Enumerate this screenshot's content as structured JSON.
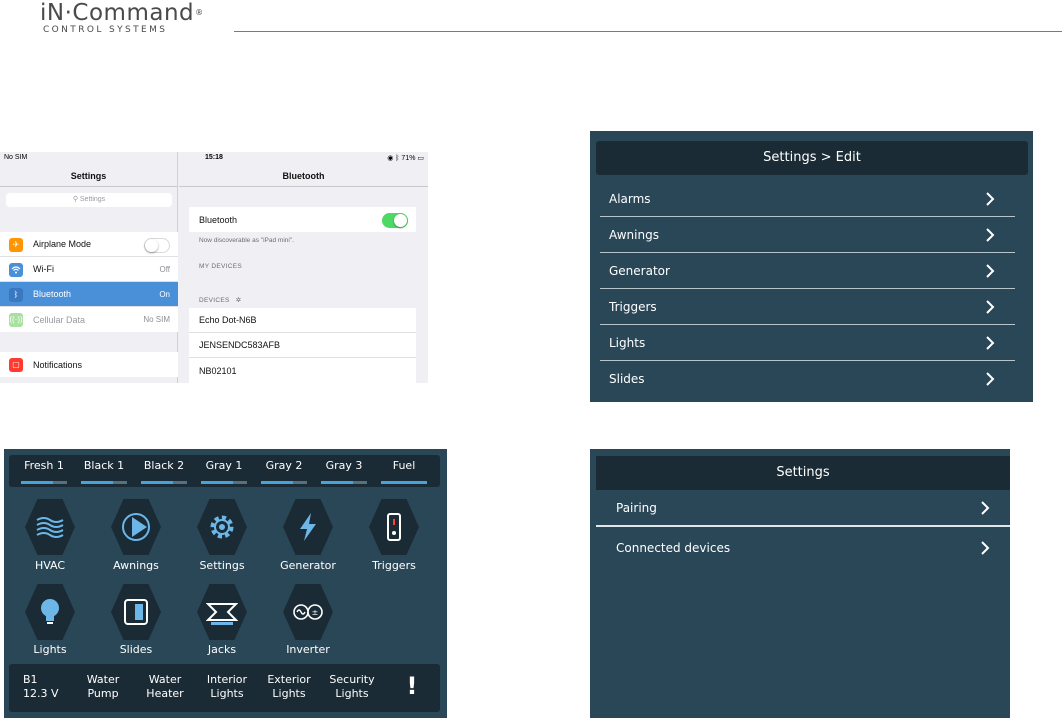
{
  "brand": {
    "name": "iN·Command",
    "registered": "®",
    "subtitle": "CONTROL SYSTEMS"
  },
  "ipad": {
    "status": {
      "carrier": "No SIM",
      "time": "15:18",
      "battery": "71%"
    },
    "left_title": "Settings",
    "search_placeholder": "Settings",
    "items": [
      {
        "label": "Airplane Mode",
        "value": "",
        "icon": "airplane-icon",
        "color": "#ff9500"
      },
      {
        "label": "Wi-Fi",
        "value": "Off",
        "icon": "wifi-icon",
        "color": "#4a90d9"
      },
      {
        "label": "Bluetooth",
        "value": "On",
        "icon": "bluetooth-icon",
        "color": "#4a90d9"
      },
      {
        "label": "Cellular Data",
        "value": "No SIM",
        "icon": "cellular-icon",
        "color": "#a8e0a0"
      }
    ],
    "notifications_label": "Notifications",
    "right_title": "Bluetooth",
    "bluetooth_label": "Bluetooth",
    "discoverable_note": "Now discoverable as \"iPad mini\".",
    "my_devices_header": "MY DEVICES",
    "devices_header": "DEVICES",
    "devices": [
      "Echo Dot-N6B",
      "JENSENDC583AFB",
      "NB02101"
    ]
  },
  "settings_edit": {
    "title": "Settings > Edit",
    "items": [
      "Alarms",
      "Awnings",
      "Generator",
      "Triggers",
      "Lights",
      "Slides"
    ]
  },
  "settings": {
    "title": "Settings",
    "items": [
      "Pairing",
      "Connected devices"
    ]
  },
  "dashboard": {
    "tanks": [
      {
        "label": "Fresh 1",
        "level": 0.7
      },
      {
        "label": "Black 1",
        "level": 0.7
      },
      {
        "label": "Black 2",
        "level": 0.7
      },
      {
        "label": "Gray 1",
        "level": 0.7
      },
      {
        "label": "Gray 2",
        "level": 0.7
      },
      {
        "label": "Gray 3",
        "level": 0.7
      },
      {
        "label": "Fuel",
        "level": 1.0
      }
    ],
    "tiles": [
      {
        "label": "HVAC",
        "icon": "hvac-icon"
      },
      {
        "label": "Awnings",
        "icon": "awning-icon"
      },
      {
        "label": "Settings",
        "icon": "gear-icon"
      },
      {
        "label": "Generator",
        "icon": "lightning-icon"
      },
      {
        "label": "Triggers",
        "icon": "trigger-switch-icon"
      },
      {
        "label": "Lights",
        "icon": "lightbulb-icon"
      },
      {
        "label": "Slides",
        "icon": "slide-icon"
      },
      {
        "label": "Jacks",
        "icon": "jack-icon"
      },
      {
        "label": "Inverter",
        "icon": "inverter-icon"
      }
    ],
    "status": [
      {
        "line1": "B1",
        "line2": "12.3 V"
      },
      {
        "line1": "Water",
        "line2": "Pump"
      },
      {
        "line1": "Water",
        "line2": "Heater"
      },
      {
        "line1": "Interior",
        "line2": "Lights"
      },
      {
        "line1": "Exterior",
        "line2": "Lights"
      },
      {
        "line1": "Security",
        "line2": "Lights"
      }
    ],
    "alert_symbol": "!"
  },
  "colors": {
    "panel": "#2a4758",
    "panel_dark": "#1a2b35",
    "ios_blue": "#4a90d9",
    "ios_green": "#4cd964"
  }
}
